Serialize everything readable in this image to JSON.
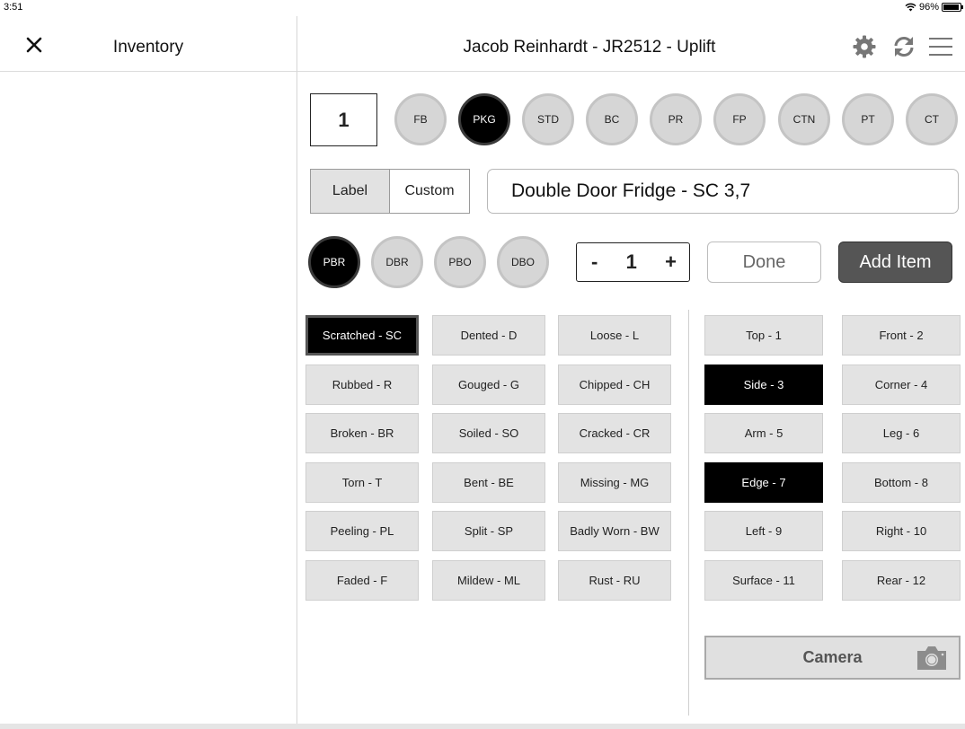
{
  "status": {
    "time": "3:51",
    "battery": "96%",
    "battery_level": 0.96
  },
  "left": {
    "title": "Inventory"
  },
  "header": {
    "title": "Jacob Reinhardt - JR2512 - Uplift"
  },
  "quantity_box": "1",
  "packing_codes": [
    {
      "label": "FB",
      "selected": false
    },
    {
      "label": "PKG",
      "selected": true
    },
    {
      "label": "STD",
      "selected": false
    },
    {
      "label": "BC",
      "selected": false
    },
    {
      "label": "PR",
      "selected": false
    },
    {
      "label": "FP",
      "selected": false
    },
    {
      "label": "CTN",
      "selected": false
    },
    {
      "label": "PT",
      "selected": false
    },
    {
      "label": "CT",
      "selected": false
    }
  ],
  "segment": {
    "label": "Label",
    "custom": "Custom"
  },
  "item_name": "Double Door Fridge - SC 3,7",
  "condition_codes": [
    {
      "label": "PBR",
      "selected": true
    },
    {
      "label": "DBR",
      "selected": false
    },
    {
      "label": "PBO",
      "selected": false
    },
    {
      "label": "DBO",
      "selected": false
    }
  ],
  "stepper": {
    "minus": "-",
    "value": "1",
    "plus": "+"
  },
  "buttons": {
    "done": "Done",
    "add_item": "Add Item",
    "camera": "Camera"
  },
  "damages": [
    [
      "Scratched - SC",
      "Dented - D",
      "Loose - L"
    ],
    [
      "Rubbed - R",
      "Gouged - G",
      "Chipped - CH"
    ],
    [
      "Broken - BR",
      "Soiled - SO",
      "Cracked - CR"
    ],
    [
      "Torn - T",
      "Bent - BE",
      "Missing - MG"
    ],
    [
      "Peeling - PL",
      "Split - SP",
      "Badly Worn - BW"
    ],
    [
      "Faded - F",
      "Mildew - ML",
      "Rust - RU"
    ]
  ],
  "selected_damages": [
    "Scratched - SC"
  ],
  "locations": [
    [
      "Top - 1",
      "Front - 2"
    ],
    [
      "Side - 3",
      "Corner - 4"
    ],
    [
      "Arm - 5",
      "Leg - 6"
    ],
    [
      "Edge - 7",
      "Bottom - 8"
    ],
    [
      "Left - 9",
      "Right - 10"
    ],
    [
      "Surface - 11",
      "Rear - 12"
    ]
  ],
  "selected_locations": [
    "Side - 3",
    "Edge - 7"
  ],
  "icons": {
    "close": "close-icon",
    "settings": "gear-icon",
    "sync": "refresh-icon",
    "menu": "hamburger-menu-icon",
    "camera": "camera-icon",
    "wifi": "wifi-icon",
    "battery": "battery-icon"
  }
}
